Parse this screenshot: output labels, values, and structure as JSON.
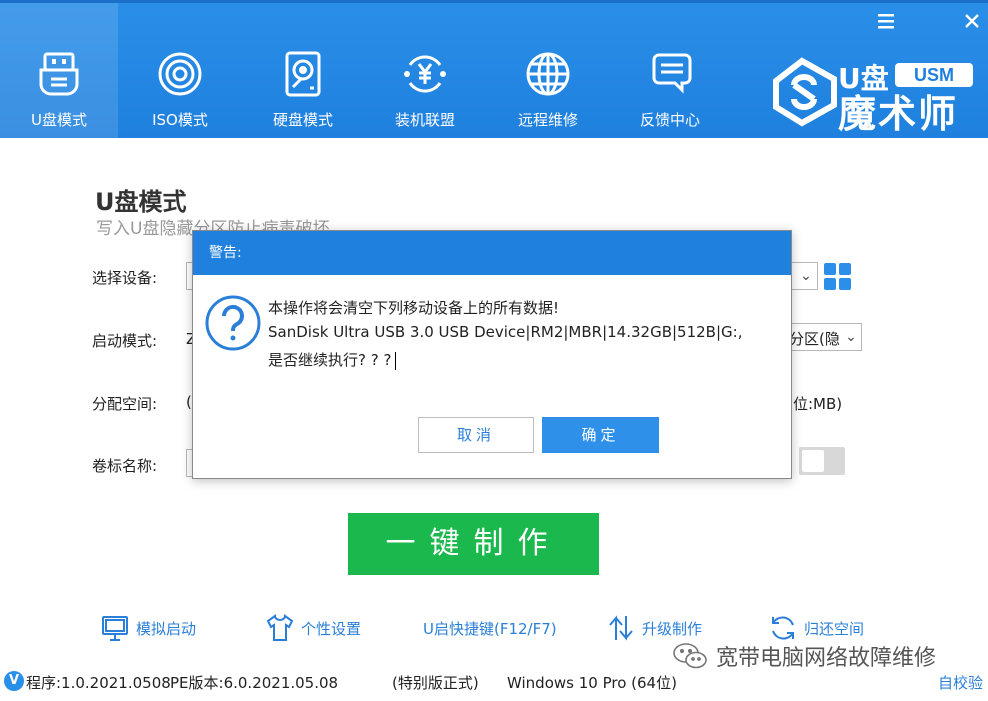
{
  "window_controls": {
    "menu_icon": "hamburger-icon",
    "close_icon": "close-icon"
  },
  "nav": {
    "items": [
      {
        "label": "U盘模式",
        "icon": "usb-drive-icon",
        "active": true
      },
      {
        "label": "ISO模式",
        "icon": "disc-icon",
        "active": false
      },
      {
        "label": "硬盘模式",
        "icon": "hard-disk-icon",
        "active": false
      },
      {
        "label": "装机联盟",
        "icon": "yen-cycle-icon",
        "active": false
      },
      {
        "label": "远程维修",
        "icon": "globe-icon",
        "active": false
      },
      {
        "label": "反馈中心",
        "icon": "chat-icon",
        "active": false
      }
    ]
  },
  "brand": {
    "top": "U盘",
    "badge": "USM",
    "main": "魔术师"
  },
  "page": {
    "title": "U盘模式",
    "subtitle": "写入U盘隐藏分区防止病毒破坏"
  },
  "form": {
    "device_label": "选择设备:",
    "boot_label": "启动模式:",
    "boot_value_prefix": "Z",
    "partition_value_right": "分区(隐",
    "space_label": "分配空间:",
    "space_value_prefix": "(",
    "space_unit_right": "位:MB)",
    "volume_label": "卷标名称:"
  },
  "make_button": {
    "label": "一键制作"
  },
  "tools": [
    {
      "label": "模拟启动",
      "icon": "monitor-icon"
    },
    {
      "label": "个性设置",
      "icon": "shirt-icon"
    },
    {
      "label": "U启快捷键(F12/F7)",
      "icon": ""
    },
    {
      "label": "升级制作",
      "icon": "up-down-arrows-icon"
    },
    {
      "label": "归还空间",
      "icon": "refresh-icon"
    }
  ],
  "status": {
    "badge": "V",
    "program_version": "程序:1.0.2021.0508",
    "pe_version": "PE版本:6.0.2021.05.08",
    "edition": "(特别版正式)",
    "os": "Windows 10 Pro (64位)",
    "self_check": "自校验"
  },
  "watermark": {
    "text": "宽带电脑网络故障维修",
    "icon": "wechat-icon"
  },
  "dialog": {
    "title": "警告:",
    "icon": "question-icon",
    "line1": "本操作将会清空下列移动设备上的所有数据!",
    "line2": "SanDisk Ultra USB 3.0 USB Device|RM2|MBR|14.32GB|512B|G:,",
    "line3": "是否继续执行? ? ?",
    "cancel_label": "取消",
    "ok_label": "确定"
  },
  "colors": {
    "primary": "#1f80de",
    "make_button": "#1bb84d",
    "link": "#2b7fd8"
  }
}
